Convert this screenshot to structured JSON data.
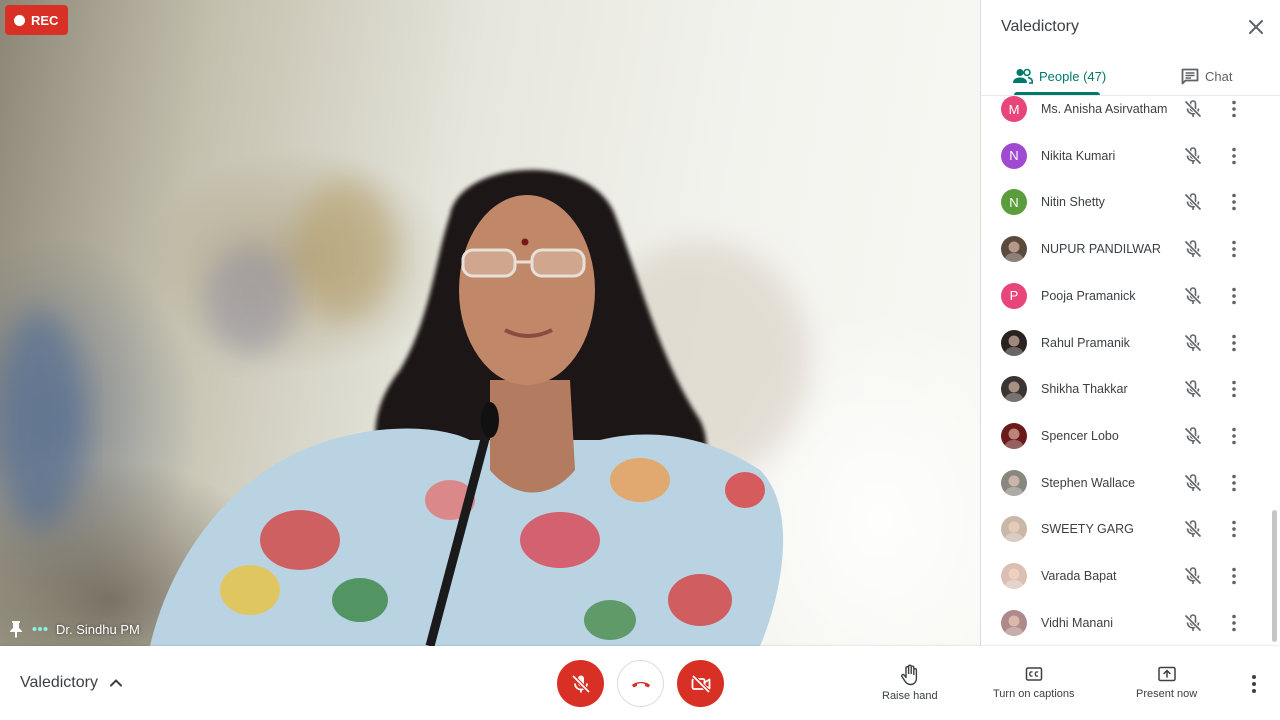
{
  "video": {
    "rec_label": "REC",
    "speaker_name": "Dr. Sindhu PM"
  },
  "panel": {
    "title": "Valedictory",
    "tabs": {
      "people": "People (47)",
      "chat": "Chat"
    },
    "people": [
      {
        "name": "Ms. Anisha Asirvatham",
        "initial": "M",
        "color": "#e8457a"
      },
      {
        "name": "Nikita Kumari",
        "initial": "N",
        "color": "#a04ad1"
      },
      {
        "name": "Nitin Shetty",
        "initial": "N",
        "color": "#5a9e3c"
      },
      {
        "name": "NUPUR PANDILWAR",
        "initial": "",
        "color": "#5b4a3e"
      },
      {
        "name": "Pooja Pramanick",
        "initial": "P",
        "color": "#e8457a"
      },
      {
        "name": "Rahul Pramanik",
        "initial": "",
        "color": "#2a2220"
      },
      {
        "name": "Shikha Thakkar",
        "initial": "",
        "color": "#3a3532"
      },
      {
        "name": "Spencer Lobo",
        "initial": "",
        "color": "#6a1a1a"
      },
      {
        "name": "Stephen Wallace",
        "initial": "",
        "color": "#8a8780"
      },
      {
        "name": "SWEETY GARG",
        "initial": "",
        "color": "#c9b7a8"
      },
      {
        "name": "Varada Bapat",
        "initial": "",
        "color": "#d9c0b2"
      },
      {
        "name": "Vidhi Manani",
        "initial": "",
        "color": "#b08a8a"
      }
    ]
  },
  "bottombar": {
    "meeting_name": "Valedictory",
    "raise_hand": "Raise hand",
    "captions": "Turn on captions",
    "present": "Present now"
  },
  "colors": {
    "accent": "#00796b",
    "danger": "#d93025"
  }
}
